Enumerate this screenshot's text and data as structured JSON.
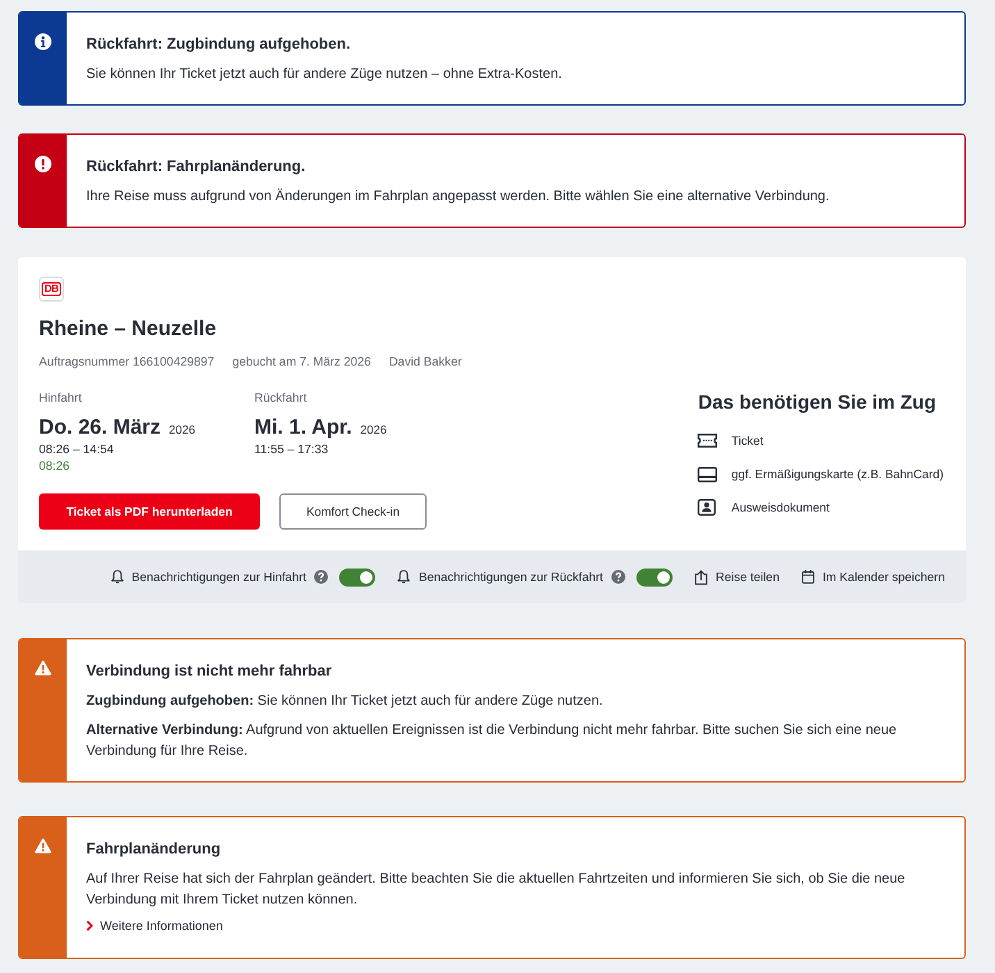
{
  "notices_top": [
    {
      "kind": "info",
      "title": "Rückfahrt: Zugbindung aufgehoben.",
      "paragraphs": [
        "Sie können Ihr Ticket jetzt auch für andere Züge nutzen – ohne Extra-Kosten."
      ]
    },
    {
      "kind": "error",
      "title": "Rückfahrt: Fahrplanänderung.",
      "paragraphs": [
        "Ihre Reise muss aufgrund von Änderungen im Fahrplan angepasst werden. Bitte wählen Sie eine alternative Verbindung."
      ]
    }
  ],
  "booking": {
    "logo": "DB",
    "route": "Rheine – Neuzelle",
    "meta": [
      "Auftragsnummer 166100429897",
      "gebucht am 7. März 2026",
      "David Bakker"
    ],
    "legs": [
      {
        "label": "Hinfahrt",
        "date": "Do. 26. März",
        "year": "2026",
        "times": "08:26 – 14:54",
        "realtime": "08:26"
      },
      {
        "label": "Rückfahrt",
        "date": "Mi. 1. Apr.",
        "year": "2026",
        "times": "11:55 – 17:33"
      }
    ],
    "buttons": [
      {
        "kind": "primary",
        "label": "Ticket als PDF herunterladen"
      },
      {
        "kind": "secondary",
        "label": "Komfort Check-in"
      }
    ],
    "requirements": {
      "title": "Das benötigen Sie im Zug",
      "items": [
        {
          "kind": "ticket",
          "label": "Ticket"
        },
        {
          "kind": "card",
          "label": "ggf. Ermäßigungskarte (z.B. BahnCard)"
        },
        {
          "kind": "id",
          "label": "Ausweisdokument"
        }
      ]
    },
    "actions": [
      {
        "kind": "toggle",
        "label": "Benachrichtigungen zur Hinfahrt",
        "on": true
      },
      {
        "kind": "toggle",
        "label": "Benachrichtigungen zur Rückfahrt",
        "on": true
      },
      {
        "kind": "share",
        "label": "Reise teilen"
      },
      {
        "kind": "calendar",
        "label": "Im Kalender speichern"
      }
    ]
  },
  "notices_bottom": [
    {
      "kind": "warning",
      "title": "Verbindung ist nicht mehr fahrbar",
      "paragraphs": [
        "**Zugbindung aufgehoben:** Sie können Ihr Ticket jetzt auch für andere Züge nutzen.",
        "**Alternative Verbindung:** Aufgrund von aktuellen Ereignissen ist die Verbindung nicht mehr fahrbar. Bitte suchen Sie sich eine neue Verbindung für Ihre Reise."
      ]
    },
    {
      "kind": "warning",
      "title": "Fahrplanänderung",
      "paragraphs": [
        "Auf Ihrer Reise hat sich der Fahrplan geändert. Bitte beachten Sie die aktuellen Fahrtzeiten und informieren Sie sich, ob Sie die neue Verbindung mit Ihrem Ticket nutzen können."
      ],
      "link": "Weitere Informationen"
    }
  ]
}
